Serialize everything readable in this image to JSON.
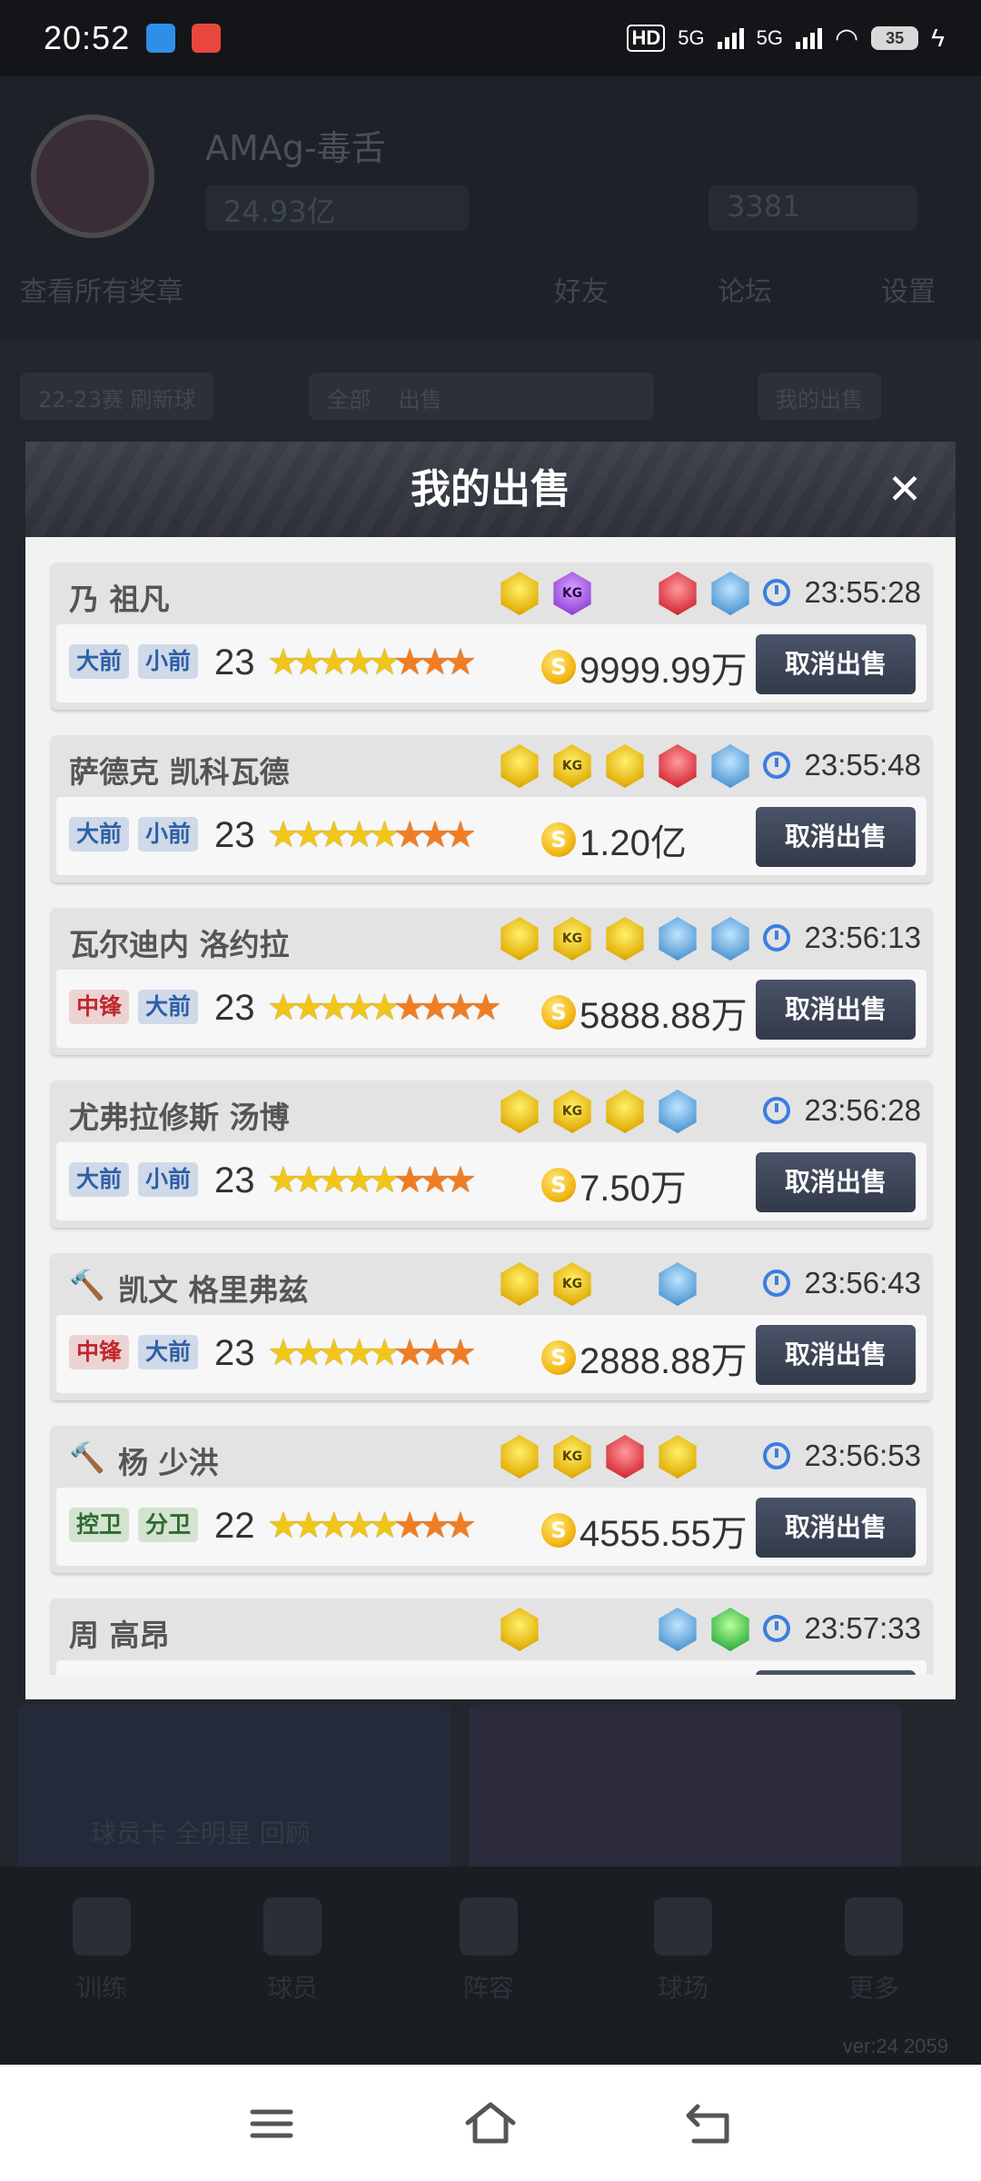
{
  "status_bar": {
    "time": "20:52",
    "hd_label": "HD",
    "network_1": "5G",
    "network_2": "5G",
    "battery": "35"
  },
  "background": {
    "app_name": "AMAg-毒舌",
    "currency_1": "24.93亿",
    "currency_2": "3381",
    "row2_left": "查看所有奖章",
    "row2_right_1": "好友",
    "row2_right_2": "论坛",
    "row2_right_3": "设置",
    "pill_1": "22-23赛 刷新球",
    "pill_2a": "全部",
    "pill_2b": "出售",
    "pill_3": "我的出售",
    "bottom_caption": "球员卡 全明星 回顾",
    "nav_labels": [
      "训练",
      "球员",
      "阵容",
      "球场",
      "更多"
    ],
    "version": "ver:24 2059"
  },
  "modal": {
    "title": "我的出售",
    "close_label": "✕",
    "cancel_label": "取消出售",
    "coin_symbol": "S",
    "items": [
      {
        "name": "乃 祖凡",
        "time": "23:55:28",
        "positions": [
          "大前",
          "小前"
        ],
        "age": "23",
        "gold_stars": 5,
        "orange_stars": 3,
        "price": "9999.99万",
        "auction": false
      },
      {
        "name": "萨德克 凯科瓦德",
        "time": "23:55:48",
        "positions": [
          "大前",
          "小前"
        ],
        "age": "23",
        "gold_stars": 5,
        "orange_stars": 3,
        "price": "1.20亿",
        "auction": false
      },
      {
        "name": "瓦尔迪内 洛约拉",
        "time": "23:56:13",
        "positions": [
          "中锋",
          "大前"
        ],
        "age": "23",
        "gold_stars": 5,
        "orange_stars": 4,
        "price": "5888.88万",
        "auction": false
      },
      {
        "name": "尤弗拉修斯 汤博",
        "time": "23:56:28",
        "positions": [
          "大前",
          "小前"
        ],
        "age": "23",
        "gold_stars": 5,
        "orange_stars": 3,
        "price": "7.50万",
        "auction": false
      },
      {
        "name": "凯文 格里弗兹",
        "time": "23:56:43",
        "positions": [
          "中锋",
          "大前"
        ],
        "age": "23",
        "gold_stars": 5,
        "orange_stars": 3,
        "price": "2888.88万",
        "auction": true
      },
      {
        "name": "杨 少洪",
        "time": "23:56:53",
        "positions": [
          "控卫",
          "分卫"
        ],
        "age": "22",
        "gold_stars": 5,
        "orange_stars": 3,
        "price": "4555.55万",
        "auction": true
      },
      {
        "name": "周 高昂",
        "time": "23:57:33",
        "positions": [],
        "age": "",
        "gold_stars": 0,
        "orange_stars": 0,
        "price": "",
        "auction": false
      }
    ],
    "badge_rows": [
      [
        {
          "x": 0,
          "c": "gold",
          "t": ""
        },
        {
          "x": 1,
          "c": "purple",
          "t": "KG"
        },
        {
          "x": 3,
          "c": "red",
          "t": ""
        },
        {
          "x": 4,
          "c": "blue",
          "t": ""
        }
      ],
      [
        {
          "x": 0,
          "c": "gold",
          "t": ""
        },
        {
          "x": 1,
          "c": "gold",
          "t": "KG"
        },
        {
          "x": 2,
          "c": "gold",
          "t": ""
        },
        {
          "x": 3,
          "c": "red",
          "t": ""
        },
        {
          "x": 4,
          "c": "blue",
          "t": ""
        }
      ],
      [
        {
          "x": 0,
          "c": "gold",
          "t": ""
        },
        {
          "x": 1,
          "c": "gold",
          "t": "KG"
        },
        {
          "x": 2,
          "c": "gold",
          "t": ""
        },
        {
          "x": 3,
          "c": "blue",
          "t": ""
        },
        {
          "x": 4,
          "c": "blue",
          "t": ""
        }
      ],
      [
        {
          "x": 0,
          "c": "gold",
          "t": ""
        },
        {
          "x": 1,
          "c": "gold",
          "t": "KG"
        },
        {
          "x": 2,
          "c": "gold",
          "t": ""
        },
        {
          "x": 3,
          "c": "blue",
          "t": ""
        }
      ],
      [
        {
          "x": 0,
          "c": "gold",
          "t": ""
        },
        {
          "x": 1,
          "c": "gold",
          "t": "KG"
        },
        {
          "x": 3,
          "c": "blue",
          "t": ""
        }
      ],
      [
        {
          "x": 0,
          "c": "gold",
          "t": ""
        },
        {
          "x": 1,
          "c": "gold",
          "t": "KG"
        },
        {
          "x": 2,
          "c": "red",
          "t": ""
        },
        {
          "x": 3,
          "c": "gold",
          "t": ""
        }
      ],
      [
        {
          "x": 0,
          "c": "gold",
          "t": ""
        },
        {
          "x": 3,
          "c": "blue",
          "t": ""
        },
        {
          "x": 4,
          "c": "green",
          "t": ""
        }
      ]
    ]
  },
  "colors": {
    "modal_header": "#2c3038",
    "cancel_button": "#323949",
    "timer_icon": "#3b7ee0",
    "star_gold": "#f1c618",
    "star_orange": "#f07d22"
  }
}
